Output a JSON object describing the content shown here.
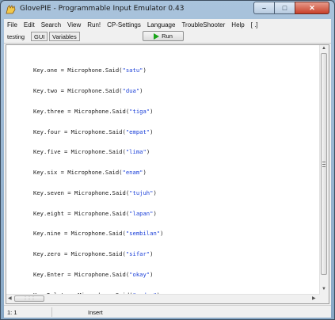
{
  "window": {
    "title": "GlovePIE - Programmable Input Emulator 0.43",
    "colors": {
      "frame": "#a9c3dc",
      "close": "#c8402a",
      "string": "#1a3fd8",
      "run": "#1aa51a"
    }
  },
  "menu": {
    "items": [
      {
        "label": "File"
      },
      {
        "label": "Edit"
      },
      {
        "label": "Search"
      },
      {
        "label": "View"
      },
      {
        "label": "Run!"
      },
      {
        "label": "CP-Settings"
      },
      {
        "label": "Language"
      },
      {
        "label": "TroubleShooter"
      },
      {
        "label": "Help"
      },
      {
        "label": "[ .]"
      }
    ]
  },
  "toolbar": {
    "tabs": [
      {
        "label": "testing"
      },
      {
        "label": "GUI"
      },
      {
        "label": "Variables"
      }
    ],
    "run_label": "Run"
  },
  "editor": {
    "lines": [
      {
        "prefix": "Key.one = Microphone.Said(",
        "arg": "\"satu\"",
        "suffix": ")"
      },
      {
        "prefix": "Key.two = Microphone.Said(",
        "arg": "\"dua\"",
        "suffix": ")"
      },
      {
        "prefix": "Key.three = Microphone.Said(",
        "arg": "\"tiga\"",
        "suffix": ")"
      },
      {
        "prefix": "Key.four = Microphone.Said(",
        "arg": "\"empat\"",
        "suffix": ")"
      },
      {
        "prefix": "Key.five = Microphone.Said(",
        "arg": "\"lima\"",
        "suffix": ")"
      },
      {
        "prefix": "Key.six = Microphone.Said(",
        "arg": "\"enam\"",
        "suffix": ")"
      },
      {
        "prefix": "Key.seven = Microphone.Said(",
        "arg": "\"tujuh\"",
        "suffix": ")"
      },
      {
        "prefix": "Key.eight = Microphone.Said(",
        "arg": "\"lapan\"",
        "suffix": ")"
      },
      {
        "prefix": "Key.nine = Microphone.Said(",
        "arg": "\"sembilan\"",
        "suffix": ")"
      },
      {
        "prefix": "Key.zero = Microphone.Said(",
        "arg": "\"sifar\"",
        "suffix": ")"
      },
      {
        "prefix": "Key.Enter = Microphone.Said(",
        "arg": "\"okay\"",
        "suffix": ")"
      },
      {
        "prefix": "Key.Delete = Microphone.Said(",
        "arg": "\"padam\"",
        "suffix": ")"
      }
    ]
  },
  "status": {
    "position": "1: 1",
    "mode": "Insert"
  }
}
